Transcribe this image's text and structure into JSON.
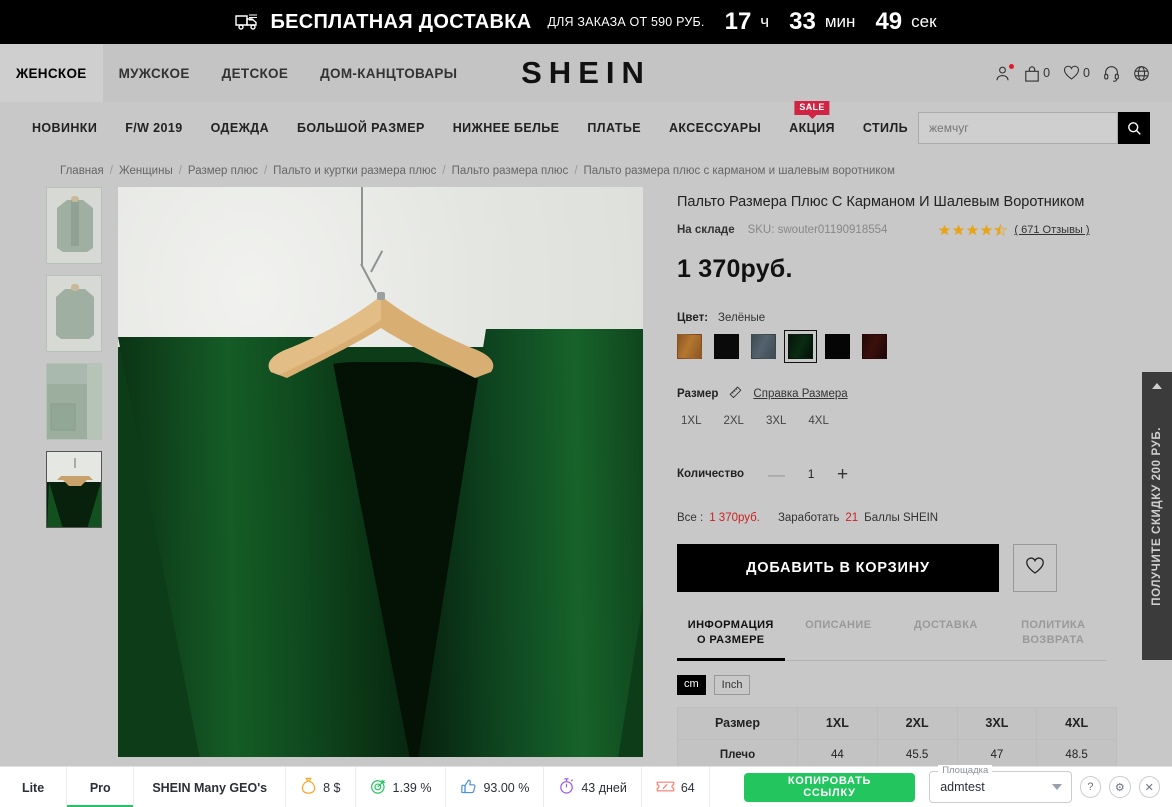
{
  "countdown": {
    "icon": "delivery-truck-icon",
    "headline": "БЕСПЛАТНАЯ ДОСТАВКА",
    "subline": "ДЛЯ ЗАКАЗА ОТ 590 РУБ.",
    "hours": "17",
    "hours_unit": "ч",
    "minutes": "33",
    "minutes_unit": "мин",
    "seconds": "49",
    "seconds_unit": "сек"
  },
  "header": {
    "logo": "SHEIN",
    "top_categories": [
      {
        "label": "ЖЕНСКОЕ",
        "active": true
      },
      {
        "label": "МУЖСКОЕ",
        "active": false
      },
      {
        "label": "ДЕТСКОЕ",
        "active": false
      },
      {
        "label": "ДОМ-КАНЦТОВАРЫ",
        "active": false
      }
    ],
    "icons": [
      {
        "name": "account-icon",
        "count": ""
      },
      {
        "name": "shopping-bag-icon",
        "count": "0"
      },
      {
        "name": "wishlist-heart-icon",
        "count": "0"
      },
      {
        "name": "support-headset-icon",
        "count": ""
      },
      {
        "name": "language-globe-icon",
        "count": ""
      }
    ]
  },
  "nav": {
    "items": [
      {
        "label": "НОВИНКИ",
        "badge": ""
      },
      {
        "label": "F/W 2019",
        "badge": ""
      },
      {
        "label": "ОДЕЖДА",
        "badge": ""
      },
      {
        "label": "БОЛЬШОЙ РАЗМЕР",
        "badge": ""
      },
      {
        "label": "НИЖНЕЕ БЕЛЬЕ",
        "badge": ""
      },
      {
        "label": "ПЛАТЬЕ",
        "badge": ""
      },
      {
        "label": "АКСЕССУАРЫ",
        "badge": ""
      },
      {
        "label": "АКЦИЯ",
        "badge": "SALE"
      },
      {
        "label": "СТИЛЬ",
        "badge": ""
      }
    ],
    "search_placeholder": "жемчуг",
    "search_value": ""
  },
  "breadcrumb": [
    "Главная",
    "Женщины",
    "Размер плюс",
    "Пальто и куртки размера плюс",
    "Пальто размера плюс",
    "Пальто размера плюс с карманом и шалевым воротником"
  ],
  "gallery": {
    "thumbnails": [
      {
        "name": "thumb-front-view",
        "selected": false
      },
      {
        "name": "thumb-back-view",
        "selected": false
      },
      {
        "name": "thumb-pocket-detail",
        "selected": false
      },
      {
        "name": "thumb-collar-hanger",
        "selected": true
      }
    ]
  },
  "product": {
    "title": "Пальто Размера Плюс С Карманом И Шалевым Воротником",
    "stock_label": "На складе",
    "sku": "SKU: swouter01190918554",
    "rating": 4.5,
    "reviews_label": "( 671 Отзывы )",
    "price": "1 370руб.",
    "color_label": "Цвет:",
    "color_value": "Зелёные",
    "colors": [
      {
        "name": "camel",
        "hex": "#a8682e",
        "selected": false
      },
      {
        "name": "black",
        "hex": "#0a0a0a",
        "selected": false
      },
      {
        "name": "slate-blue",
        "hex": "#46545e",
        "selected": false
      },
      {
        "name": "dark-green",
        "hex": "#061a09",
        "selected": true
      },
      {
        "name": "black-2",
        "hex": "#050505",
        "selected": false
      },
      {
        "name": "dark-maroon",
        "hex": "#2b0c0b",
        "selected": false
      }
    ],
    "size_label": "Размер",
    "size_guide_label": "Справка Размера",
    "sizes": [
      "1XL",
      "2XL",
      "3XL",
      "4XL"
    ],
    "quantity_label": "Количество",
    "quantity_value": "1",
    "minus_symbol": "—",
    "plus_symbol": "+",
    "total_label": "Все :",
    "total_value": "1 370руб.",
    "earn_label": "Заработать",
    "earn_points": "21",
    "earn_suffix": "Баллы SHEIN",
    "add_to_cart_label": "ДОБАВИТЬ В КОРЗИНУ",
    "wishlist_icon": "heart-outline-icon"
  },
  "tabs": {
    "items": [
      {
        "label": "ИНФОРМАЦИЯ О РАЗМЕРЕ",
        "active": true
      },
      {
        "label": "ОПИСАНИЕ",
        "active": false
      },
      {
        "label": "ДОСТАВКА",
        "active": false
      },
      {
        "label": "ПОЛИТИКА ВОЗВРАТА",
        "active": false
      }
    ],
    "units": [
      {
        "label": "cm",
        "active": true
      },
      {
        "label": "Inch",
        "active": false
      }
    ]
  },
  "size_table": {
    "header": [
      "Размер",
      "1XL",
      "2XL",
      "3XL",
      "4XL"
    ],
    "rows": [
      [
        "Плечо",
        "44",
        "45.5",
        "47",
        "48.5"
      ]
    ]
  },
  "side_banner": {
    "text": "ПОЛУЧИТЕ СКИДКУ 200 РУБ.",
    "arrow_icon": "triangle-up-icon"
  },
  "bottombar": {
    "tabs": [
      {
        "label": "Lite",
        "active": false
      },
      {
        "label": "Pro",
        "active": true
      }
    ],
    "title": "SHEIN Many GEO's",
    "metrics": [
      {
        "icon": "money-bag-icon",
        "value": "8 $",
        "color": "#f5a623"
      },
      {
        "icon": "target-icon",
        "value": "1.39 %",
        "color": "#22c55e"
      },
      {
        "icon": "thumbs-up-icon",
        "value": "93.00 %",
        "color": "#4a90d9"
      },
      {
        "icon": "stopwatch-icon",
        "value": "43 дней",
        "color": "#9b59e0"
      },
      {
        "icon": "coupon-icon",
        "value": "64",
        "color": "#ff7a6b"
      }
    ],
    "copy_button": "КОПИРОВАТЬ ССЫЛКУ",
    "select_legend": "Площадка",
    "select_value": "admtest",
    "actions": [
      {
        "name": "help-button",
        "glyph": "?"
      },
      {
        "name": "settings-button",
        "glyph": "⚙"
      },
      {
        "name": "close-button",
        "glyph": "✕"
      }
    ]
  }
}
